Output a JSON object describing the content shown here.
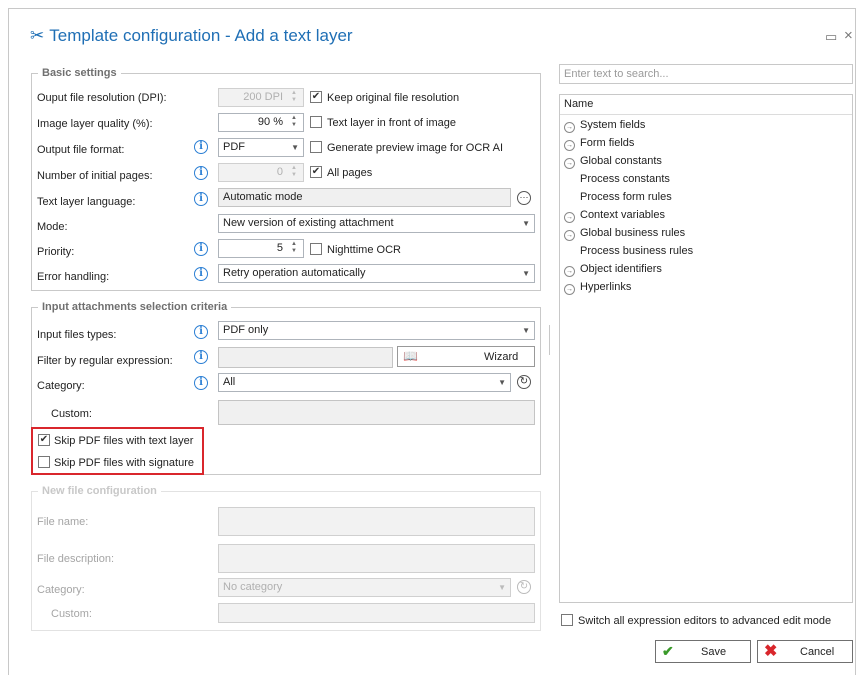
{
  "dialog": {
    "title": "Template configuration - Add a text layer",
    "minimize_glyph": "▭",
    "close_glyph": "×"
  },
  "basic_settings": {
    "legend": "Basic settings",
    "output_resolution": {
      "label": "Ouput file resolution (DPI):",
      "value": "200 DPI",
      "checkbox_label": "Keep original file resolution",
      "checked": true
    },
    "image_quality": {
      "label": "Image layer quality (%):",
      "value": "90 %",
      "checkbox_label": "Text layer in front of image",
      "checked": false
    },
    "output_format": {
      "label": "Output file format:",
      "value": "PDF",
      "checkbox_label": "Generate preview image for OCR AI",
      "checked": false
    },
    "initial_pages": {
      "label": "Number of initial pages:",
      "value": "0",
      "checkbox_label": "All pages",
      "checked": true
    },
    "text_language": {
      "label": "Text layer language:",
      "value": "Automatic mode"
    },
    "mode": {
      "label": "Mode:",
      "value": "New version of existing attachment"
    },
    "priority": {
      "label": "Priority:",
      "value": "5",
      "checkbox_label": "Nighttime OCR",
      "checked": false
    },
    "error_handling": {
      "label": "Error handling:",
      "value": "Retry operation automatically"
    }
  },
  "input_criteria": {
    "legend": "Input attachments selection criteria",
    "file_types": {
      "label": "Input files types:",
      "value": "PDF only"
    },
    "regex": {
      "label": "Filter by regular expression:",
      "value": "",
      "wizard_label": "Wizard"
    },
    "category": {
      "label": "Category:",
      "value": "All"
    },
    "custom": {
      "label": "Custom:",
      "value": ""
    },
    "skip_text_layer": {
      "label": "Skip PDF files with text layer",
      "checked": true
    },
    "skip_signature": {
      "label": "Skip PDF files with signature",
      "checked": false
    }
  },
  "new_file": {
    "legend": "New file configuration",
    "file_name": {
      "label": "File name:"
    },
    "file_description": {
      "label": "File description:"
    },
    "category": {
      "label": "Category:",
      "value": "No category"
    },
    "custom": {
      "label": "Custom:"
    }
  },
  "right_panel": {
    "search_placeholder": "Enter text to search...",
    "tree_header": "Name",
    "items": [
      {
        "label": "System fields",
        "expandable": true
      },
      {
        "label": "Form fields",
        "expandable": true
      },
      {
        "label": "Global constants",
        "expandable": true
      },
      {
        "label": "Process constants",
        "expandable": false
      },
      {
        "label": "Process form rules",
        "expandable": false
      },
      {
        "label": "Context variables",
        "expandable": true
      },
      {
        "label": "Global business rules",
        "expandable": true
      },
      {
        "label": "Process business rules",
        "expandable": false
      },
      {
        "label": "Object identifiers",
        "expandable": true
      },
      {
        "label": "Hyperlinks",
        "expandable": true
      }
    ],
    "advanced_mode": {
      "label": "Switch all expression editors to advanced edit mode",
      "checked": false
    }
  },
  "footer": {
    "save_label": "Save",
    "cancel_label": "Cancel"
  },
  "colors": {
    "title": "#1f6fb5",
    "info": "#2b7fd4",
    "highlight": "#d9262c",
    "save_icon": "#3a9a2a",
    "cancel_icon": "#d9262c"
  }
}
